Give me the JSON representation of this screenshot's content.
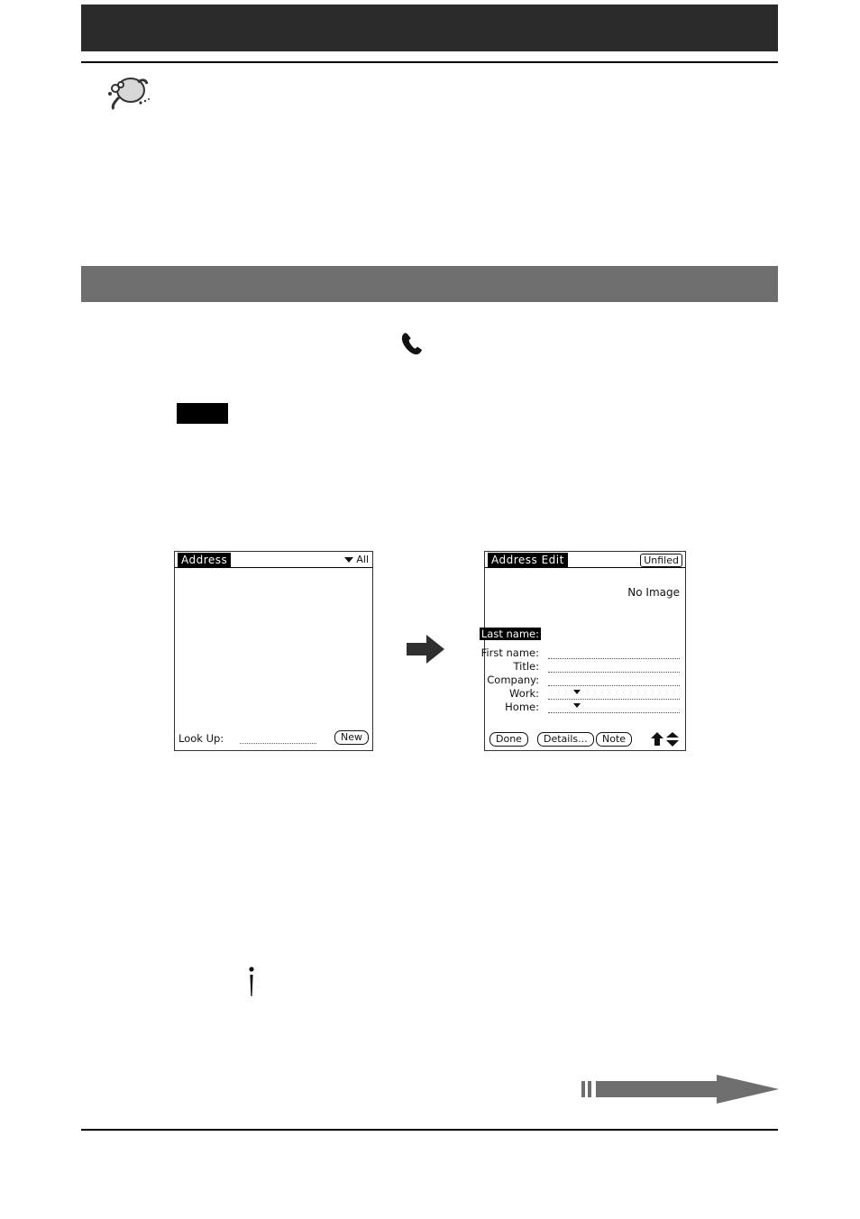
{
  "page": {
    "banner_title": "",
    "section_title": "",
    "body_text": ""
  },
  "icons": {
    "app_icon": "address-book-phone-icon",
    "phone_icon": "telephone-handset-icon",
    "stylus_icon": "stylus-tap-icon",
    "flow_arrow": "right-arrow-icon",
    "bottom_arrow": "page-forward-arrow-icon"
  },
  "pda_left": {
    "title": "Address",
    "category_label": "All",
    "category_icon": "chevron-down-icon",
    "lookup_label": "Look Up:",
    "new_button": "New"
  },
  "pda_right": {
    "title": "Address Edit",
    "category_button": "Unfiled",
    "image_placeholder": "No Image",
    "fields": [
      {
        "label": "Last name:",
        "selected": true,
        "dropdown": false
      },
      {
        "label": "First name:",
        "selected": false,
        "dropdown": false
      },
      {
        "label": "Title:",
        "selected": false,
        "dropdown": false
      },
      {
        "label": "Company:",
        "selected": false,
        "dropdown": false
      },
      {
        "label": "Work:",
        "selected": false,
        "dropdown": true
      },
      {
        "label": "Home:",
        "selected": false,
        "dropdown": true
      }
    ],
    "buttons": {
      "done": "Done",
      "details": "Details...",
      "note": "Note"
    },
    "scroll_icons": [
      "up-arrow-icon",
      "scroll-up-icon",
      "scroll-down-icon"
    ]
  },
  "colors": {
    "banner": "#2b2b2b",
    "section_bar": "#6e6e6e",
    "rule": "#000000",
    "screen_bg": "#ffffff"
  }
}
